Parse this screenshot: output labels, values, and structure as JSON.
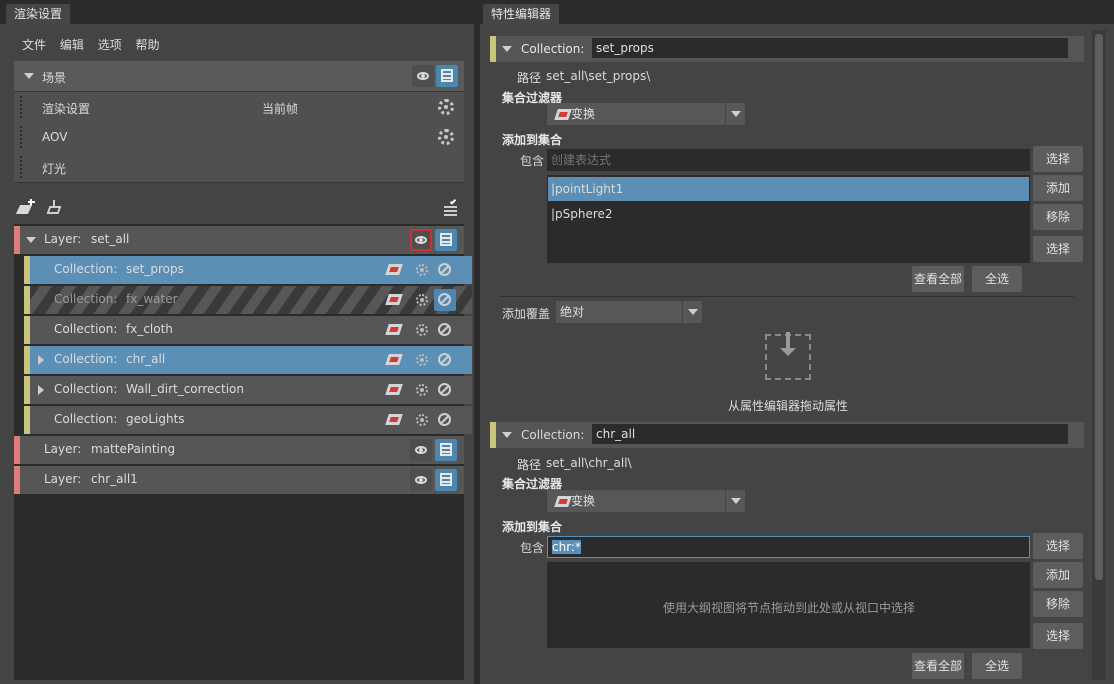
{
  "left_panel": {
    "tab": "渲染设置",
    "menu": [
      "文件",
      "编辑",
      "选项",
      "帮助"
    ],
    "scene_label": "场景",
    "render_settings_label": "渲染设置",
    "current_frame_label": "当前帧",
    "aov_label": "AOV",
    "lights_label": "灯光",
    "outliner": [
      {
        "kind": "layer",
        "prefix": "Layer:",
        "name": "set_all",
        "expanded": true
      },
      {
        "kind": "collection",
        "prefix": "Collection:",
        "name": "set_props",
        "selected": true,
        "expander": false
      },
      {
        "kind": "collection",
        "prefix": "Collection:",
        "name": "fx_water",
        "disabled": true,
        "expander": false
      },
      {
        "kind": "collection",
        "prefix": "Collection:",
        "name": "fx_cloth",
        "expander": false
      },
      {
        "kind": "collection",
        "prefix": "Collection:",
        "name": "chr_all",
        "selected": true,
        "expander": true
      },
      {
        "kind": "collection",
        "prefix": "Collection:",
        "name": "Wall_dirt_correction",
        "expander": true
      },
      {
        "kind": "collection",
        "prefix": "Collection:",
        "name": "geoLights",
        "expander": false
      },
      {
        "kind": "layer",
        "prefix": "Layer:",
        "name": "mattePainting"
      },
      {
        "kind": "layer",
        "prefix": "Layer:",
        "name": "chr_all1"
      }
    ]
  },
  "right_panel": {
    "tab": "特性编辑器",
    "sections": [
      {
        "header_label": "Collection:",
        "collection_name": "set_props",
        "path_label": "路径",
        "path_value": "set_all\\set_props\\",
        "filter_label": "集合过滤器",
        "filter_value": "变换",
        "add_label": "添加到集合",
        "include_label": "包含",
        "include_placeholder": "创建表达式",
        "include_value": "",
        "members": [
          "|pointLight1",
          "|pSphere2"
        ],
        "empty_hint": "",
        "btn_select": "选择",
        "btn_add": "添加",
        "btn_remove": "移除",
        "btn_select2": "选择",
        "btn_view_all": "查看全部",
        "btn_select_all": "全选",
        "override_label": "添加覆盖",
        "override_value": "绝对",
        "drag_hint": "从属性编辑器拖动属性"
      },
      {
        "header_label": "Collection:",
        "collection_name": "chr_all",
        "path_label": "路径",
        "path_value": "set_all\\chr_all\\",
        "filter_label": "集合过滤器",
        "filter_value": "变换",
        "add_label": "添加到集合",
        "include_label": "包含",
        "include_placeholder": "",
        "include_value": "chr:*",
        "members": [],
        "empty_hint": "使用大纲视图将节点拖动到此处或从视口中选择",
        "btn_select": "选择",
        "btn_add": "添加",
        "btn_remove": "移除",
        "btn_select2": "选择",
        "btn_view_all": "查看全部",
        "btn_select_all": "全选"
      }
    ]
  },
  "colors": {
    "selected": "#5b8fb5",
    "collection_bar": "#c9c57a",
    "layer_bar": "#e17a7a",
    "eye_highlight": "#c8323c",
    "render_icon_bg": "#4c87b0"
  }
}
